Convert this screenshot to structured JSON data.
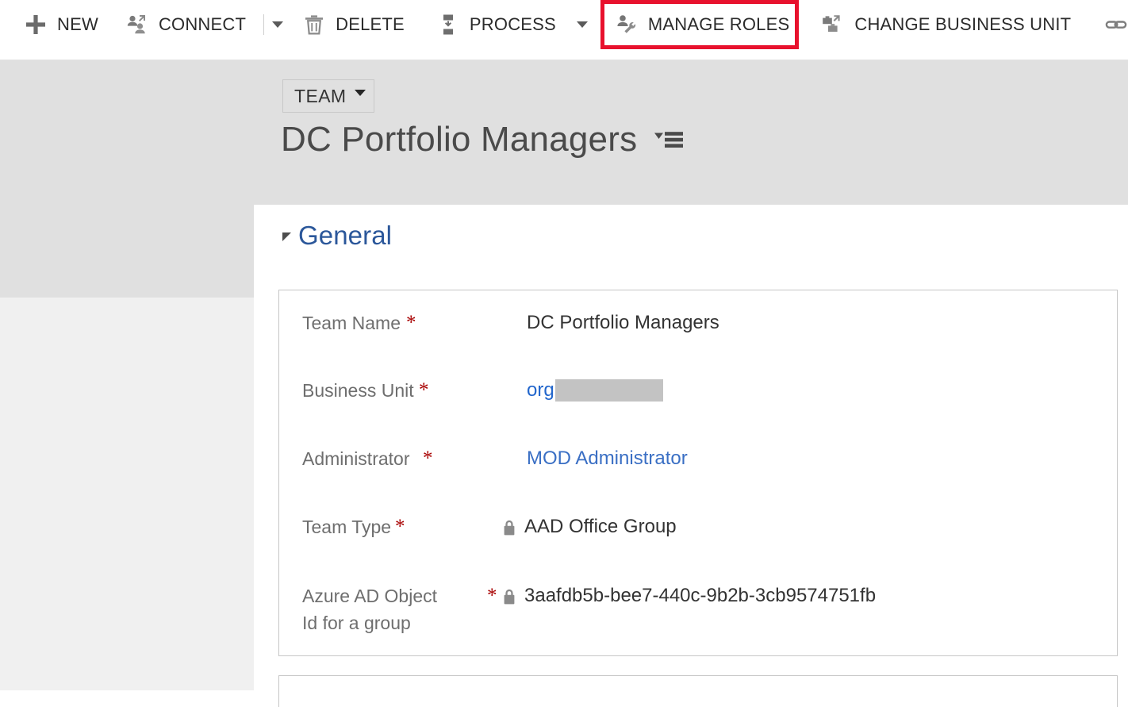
{
  "commandbar": {
    "buttons": [
      {
        "id": "new",
        "label": "NEW",
        "icon": "plus-icon"
      },
      {
        "id": "connect",
        "label": "CONNECT",
        "icon": "connect-people-icon"
      },
      {
        "id": "delete",
        "label": "DELETE",
        "icon": "trash-icon"
      },
      {
        "id": "process",
        "label": "PROCESS",
        "icon": "process-icon"
      },
      {
        "id": "manage-roles",
        "label": "MANAGE ROLES",
        "icon": "person-wrench-icon"
      },
      {
        "id": "change-bu",
        "label": "CHANGE BUSINESS UNIT",
        "icon": "briefcase-swap-icon"
      },
      {
        "id": "link",
        "label": "",
        "icon": "chain-link-icon"
      }
    ],
    "highlighted_button": "MANAGE ROLES",
    "highlight_color": "#e8112d"
  },
  "header": {
    "entity_pill": "TEAM",
    "record_title": "DC Portfolio Managers",
    "title_menu_icon": "record-set-menu-icon"
  },
  "form": {
    "section_title": "General",
    "accent_color": "#2b579a",
    "fields": [
      {
        "label": "Team Name",
        "required": true,
        "value": "DC Portfolio Managers",
        "value_kind": "text",
        "locked": false
      },
      {
        "label": "Business Unit",
        "required": true,
        "value": "org",
        "value_kind": "link-redacted",
        "locked": false
      },
      {
        "label": "Administrator",
        "required": true,
        "value": "MOD Administrator",
        "value_kind": "link",
        "locked": false
      },
      {
        "label": "Team Type",
        "required": true,
        "value": "AAD Office Group",
        "value_kind": "text",
        "locked": true
      },
      {
        "label": "Azure AD Object\nId for a group",
        "required": true,
        "value": "3aafdb5b-bee7-440c-9b2b-3cb9574751fb",
        "value_kind": "text",
        "locked": true
      }
    ]
  }
}
